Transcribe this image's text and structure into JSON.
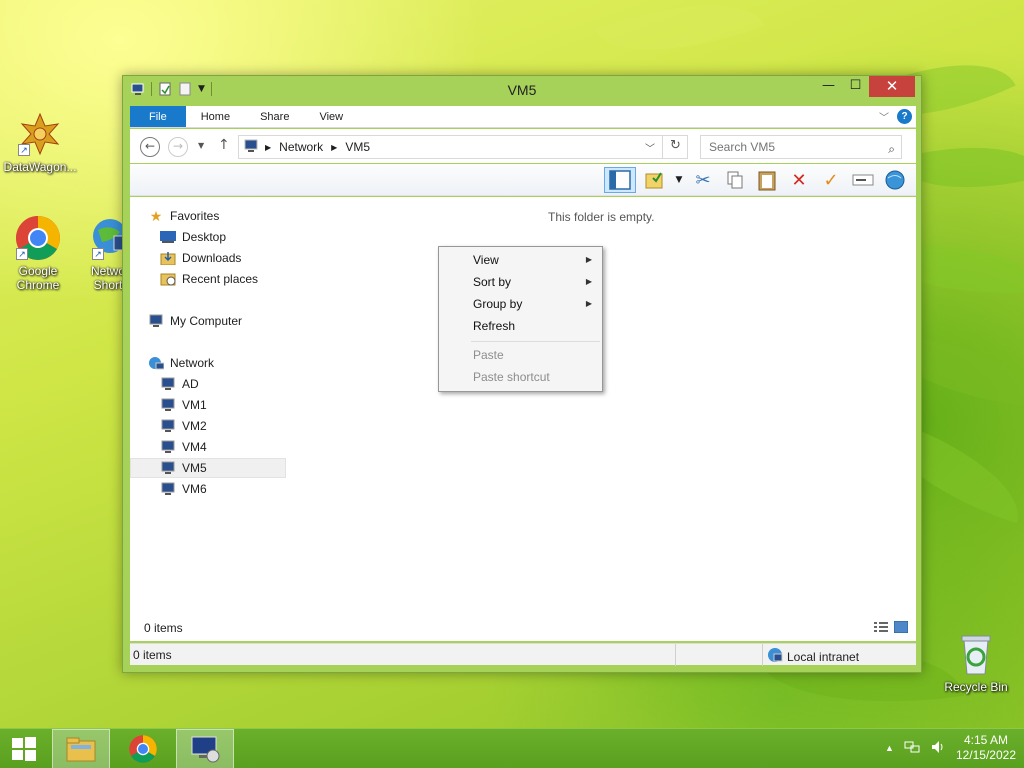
{
  "desktop": {
    "icons": [
      {
        "label": "DataWagon..."
      },
      {
        "label": "Google Chrome"
      },
      {
        "label": "Netwo Short"
      },
      {
        "label": "Recycle Bin"
      }
    ]
  },
  "window": {
    "title": "VM5",
    "controls": {
      "minimize": "—",
      "maximize": "☐",
      "close": "✕"
    },
    "ribbon_tabs": [
      "File",
      "Home",
      "Share",
      "View"
    ],
    "help_label": "?",
    "address": {
      "segments": [
        "Network",
        "VM5"
      ]
    },
    "search": {
      "placeholder": "Search VM5"
    },
    "empty_message": "This folder is empty.",
    "navigation": {
      "favorites": {
        "label": "Favorites",
        "items": [
          "Desktop",
          "Downloads",
          "Recent places"
        ]
      },
      "computer": {
        "label": "My Computer"
      },
      "network": {
        "label": "Network",
        "items": [
          "AD",
          "VM1",
          "VM2",
          "VM4",
          "VM5",
          "VM6"
        ],
        "selected": "VM5"
      }
    },
    "footer_count": "0 items",
    "status": {
      "items": "0 items",
      "zone": "Local intranet"
    }
  },
  "context_menu": {
    "items": [
      {
        "label": "View",
        "submenu": true,
        "enabled": true
      },
      {
        "label": "Sort by",
        "submenu": true,
        "enabled": true
      },
      {
        "label": "Group by",
        "submenu": true,
        "enabled": true
      },
      {
        "label": "Refresh",
        "submenu": false,
        "enabled": true
      },
      {
        "label": "Paste",
        "submenu": false,
        "enabled": false
      },
      {
        "label": "Paste shortcut",
        "submenu": false,
        "enabled": false
      }
    ]
  },
  "taskbar": {
    "clock": {
      "time": "4:15 AM",
      "date": "12/15/2022"
    }
  },
  "colors": {
    "accent": "#1979ca",
    "window_frame": "#a6d25a",
    "close_button": "#c7423c",
    "taskbar": "#5aa020"
  }
}
